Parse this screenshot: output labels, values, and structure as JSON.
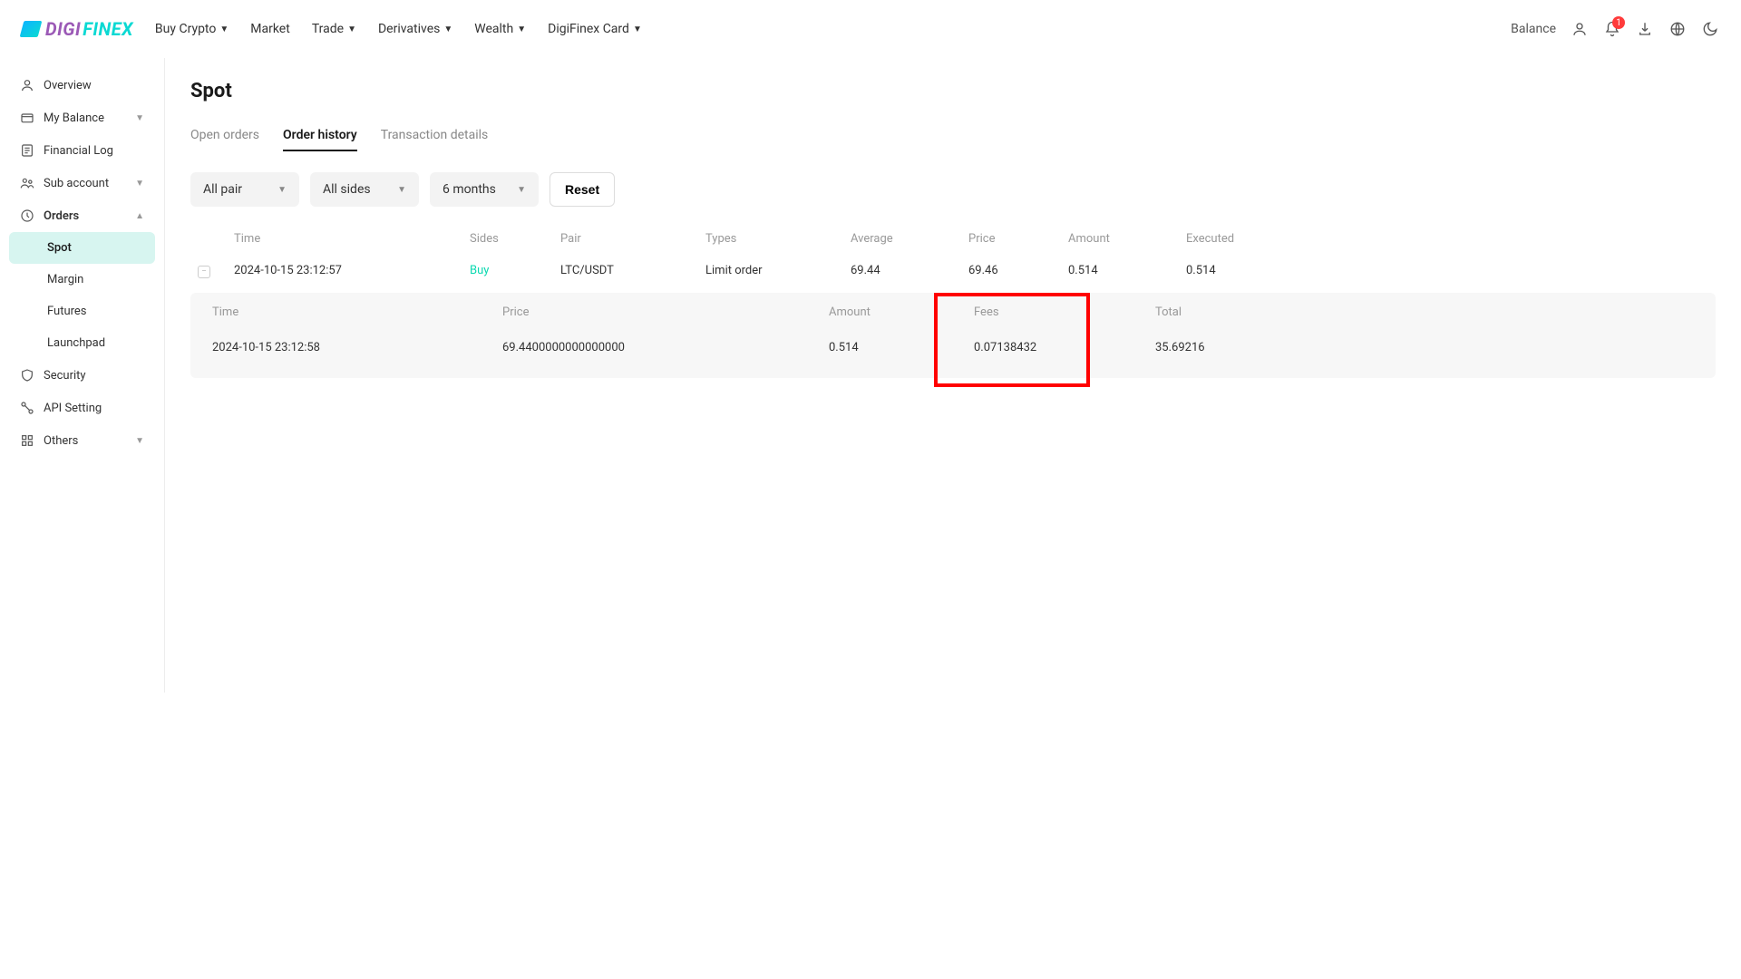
{
  "header": {
    "logo_digi": "DIGI",
    "logo_finex": "FINEX",
    "nav": [
      "Buy Crypto",
      "Market",
      "Trade",
      "Derivatives",
      "Wealth",
      "DigiFinex Card"
    ],
    "nav_has_caret": [
      true,
      false,
      true,
      true,
      true,
      true
    ],
    "balance": "Balance",
    "notif_badge": "1"
  },
  "sidebar": {
    "items": [
      {
        "label": "Overview",
        "icon": "overview-icon",
        "arrow": false
      },
      {
        "label": "My Balance",
        "icon": "balance-icon",
        "arrow": true
      },
      {
        "label": "Financial Log",
        "icon": "log-icon",
        "arrow": false
      },
      {
        "label": "Sub account",
        "icon": "subaccount-icon",
        "arrow": true
      },
      {
        "label": "Orders",
        "icon": "orders-icon",
        "arrow": true,
        "expanded": true
      }
    ],
    "order_sub": [
      "Spot",
      "Margin",
      "Futures",
      "Launchpad"
    ],
    "tail_items": [
      {
        "label": "Security",
        "icon": "security-icon",
        "arrow": false
      },
      {
        "label": "API Setting",
        "icon": "api-icon",
        "arrow": false
      },
      {
        "label": "Others",
        "icon": "grid-icon",
        "arrow": true
      }
    ]
  },
  "page": {
    "title": "Spot",
    "tabs": [
      "Open orders",
      "Order history",
      "Transaction details"
    ],
    "active_tab": 1,
    "filters": {
      "pair": "All pair",
      "side": "All sides",
      "range": "6 months",
      "reset": "Reset"
    },
    "columns": [
      "Time",
      "Sides",
      "Pair",
      "Types",
      "Average",
      "Price",
      "Amount",
      "Executed"
    ],
    "row": {
      "time": "2024-10-15 23:12:57",
      "side": "Buy",
      "pair": "LTC/USDT",
      "type": "Limit order",
      "avg": "69.44",
      "price": "69.46",
      "amount": "0.514",
      "executed": "0.514"
    },
    "detail": {
      "cols": [
        "Time",
        "Price",
        "Amount",
        "Fees",
        "Total"
      ],
      "vals": {
        "time": "2024-10-15 23:12:58",
        "price": "69.4400000000000000",
        "amount": "0.514",
        "fees": "0.07138432",
        "total": "35.69216"
      }
    }
  }
}
